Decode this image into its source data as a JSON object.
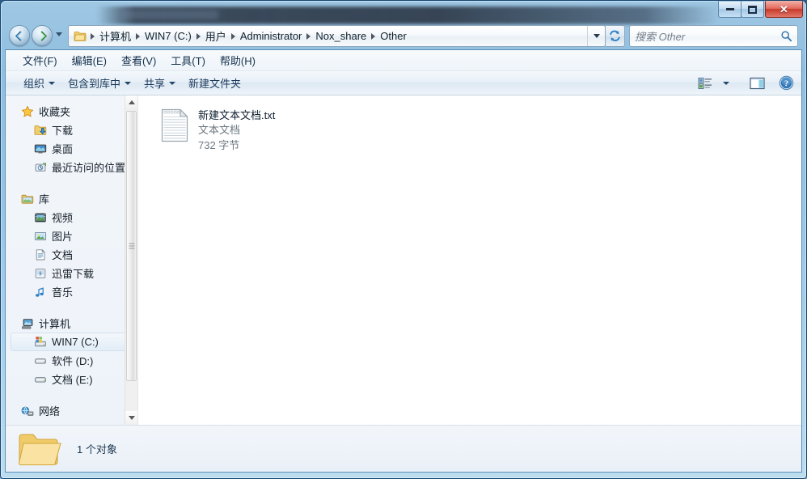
{
  "window": {
    "title": "",
    "controls": {
      "minimize_label": "最小化",
      "maximize_label": "最大化",
      "close_label": "关闭",
      "close_glyph": "✕"
    }
  },
  "nav": {
    "back_label": "后退",
    "forward_label": "前进",
    "history_dropdown_label": "最近浏览的位置",
    "refresh_label": "刷新"
  },
  "address": {
    "breadcrumbs": [
      {
        "label": "计算机"
      },
      {
        "label": "WIN7 (C:)"
      },
      {
        "label": "用户"
      },
      {
        "label": "Administrator"
      },
      {
        "label": "Nox_share"
      },
      {
        "label": "Other"
      }
    ],
    "dropdown_label": "以前的位置"
  },
  "search": {
    "placeholder": "搜索 Other",
    "value": ""
  },
  "menubar": {
    "items": [
      {
        "label": "文件(F)"
      },
      {
        "label": "编辑(E)"
      },
      {
        "label": "查看(V)"
      },
      {
        "label": "工具(T)"
      },
      {
        "label": "帮助(H)"
      }
    ]
  },
  "toolbar": {
    "items": [
      {
        "label": "组织",
        "has_caret": true
      },
      {
        "label": "包含到库中",
        "has_caret": true
      },
      {
        "label": "共享",
        "has_caret": true
      },
      {
        "label": "新建文件夹",
        "has_caret": false
      }
    ],
    "view_button_label": "更改您的视图",
    "view_caret_label": "视图选项",
    "preview_pane_label": "显示预览窗格",
    "help_label": "获取帮助"
  },
  "sidebar": {
    "groups": [
      {
        "header": {
          "label": "收藏夹",
          "icon": "star-icon"
        },
        "items": [
          {
            "label": "下载",
            "icon": "downloads-icon"
          },
          {
            "label": "桌面",
            "icon": "desktop-icon"
          },
          {
            "label": "最近访问的位置",
            "icon": "recent-places-icon"
          }
        ]
      },
      {
        "header": {
          "label": "库",
          "icon": "library-icon"
        },
        "items": [
          {
            "label": "视频",
            "icon": "videos-icon"
          },
          {
            "label": "图片",
            "icon": "pictures-icon"
          },
          {
            "label": "文档",
            "icon": "documents-icon"
          },
          {
            "label": "迅雷下载",
            "icon": "thunder-downloads-icon"
          },
          {
            "label": "音乐",
            "icon": "music-icon"
          }
        ]
      },
      {
        "header": {
          "label": "计算机",
          "icon": "computer-icon"
        },
        "items": [
          {
            "label": "WIN7 (C:)",
            "icon": "system-drive-icon",
            "selected": true
          },
          {
            "label": "软件 (D:)",
            "icon": "drive-icon"
          },
          {
            "label": "文档 (E:)",
            "icon": "drive-icon"
          }
        ]
      },
      {
        "header": {
          "label": "网络",
          "icon": "network-icon"
        },
        "items": []
      }
    ],
    "scrollbar": {
      "up_label": "向上滚动",
      "down_label": "向下滚动"
    }
  },
  "files": {
    "items": [
      {
        "name": "新建文本文档.txt",
        "type": "文本文档",
        "size": "732 字节",
        "icon": "text-file-icon"
      }
    ]
  },
  "statusbar": {
    "icon": "folder-icon",
    "text": "1 个对象"
  },
  "colors": {
    "accent": "#2b5d8c",
    "close_red": "#c63a2b",
    "selection": "#e2edf7",
    "folder_yellow": "#f7d575"
  }
}
